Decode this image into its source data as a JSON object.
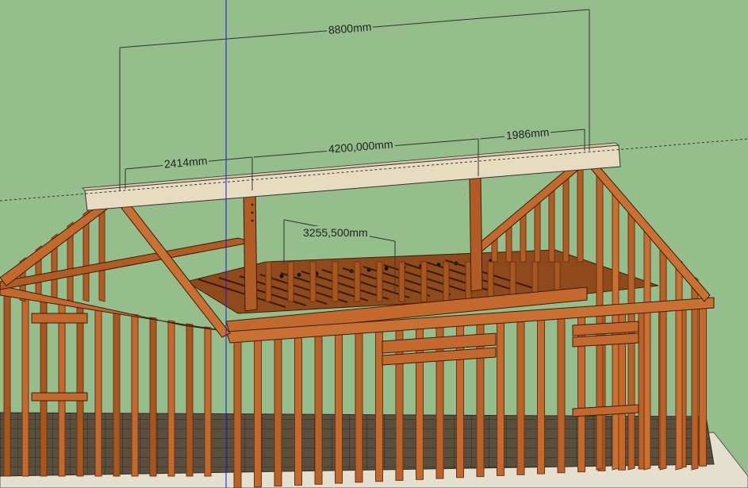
{
  "viewport": {
    "background": "#96bd8c",
    "wood_color": "#b8622a",
    "wood_dark": "#6b3412",
    "beam_color": "#e8dcc0",
    "floor_color": "#5a4e3e"
  },
  "dimensions": {
    "overall": "8800mm",
    "left_segment": "2414mm",
    "middle_segment": "4200,000mm",
    "right_segment": "1986mm",
    "joist_span": "3255,500mm"
  }
}
